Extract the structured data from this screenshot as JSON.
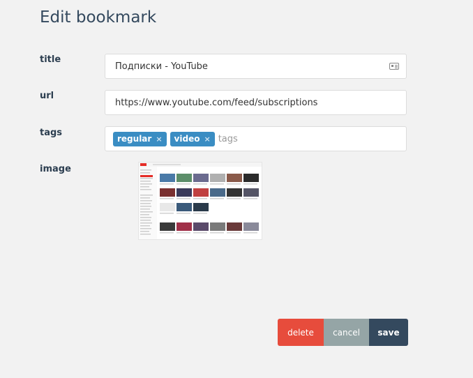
{
  "page": {
    "title": "Edit bookmark"
  },
  "form": {
    "title_label": "title",
    "title_value": "Подписки - YouTube",
    "url_label": "url",
    "url_value": "https://www.youtube.com/feed/subscriptions",
    "tags_label": "tags",
    "tags": [
      {
        "label": "regular",
        "remove": "×"
      },
      {
        "label": "video",
        "remove": "×"
      }
    ],
    "tags_placeholder": "tags",
    "image_label": "image"
  },
  "buttons": {
    "delete": "delete",
    "cancel": "cancel",
    "save": "save"
  },
  "colors": {
    "delete": "#e74c3c",
    "cancel": "#95a5a6",
    "save": "#34495e",
    "tag": "#3a8dc3"
  }
}
